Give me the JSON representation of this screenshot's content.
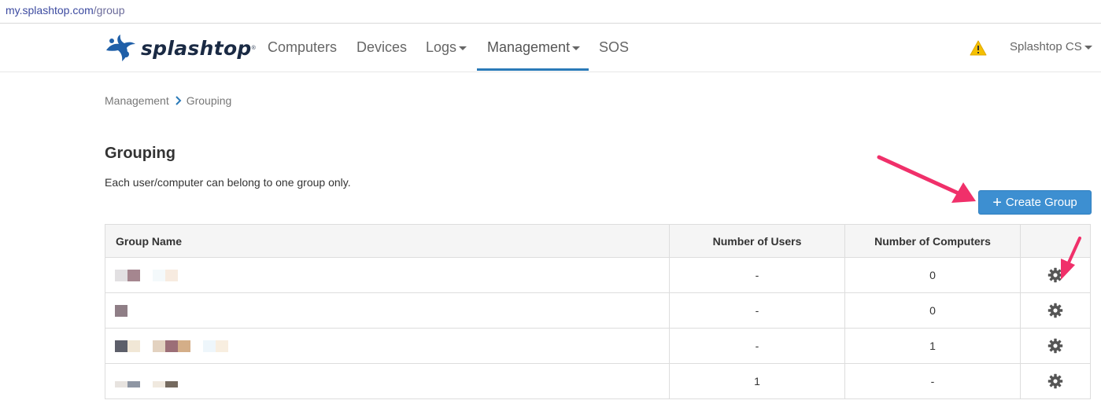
{
  "browser": {
    "url_host": "my.splashtop.com",
    "url_path": "/group"
  },
  "nav": {
    "brand": "splashtop",
    "items": [
      {
        "label": "Computers",
        "dropdown": false
      },
      {
        "label": "Devices",
        "dropdown": false
      },
      {
        "label": "Logs",
        "dropdown": true
      },
      {
        "label": "Management",
        "dropdown": true,
        "active": true
      },
      {
        "label": "SOS",
        "dropdown": false
      }
    ],
    "warning_icon": "warning-triangle-icon",
    "account_label": "Splashtop CS"
  },
  "breadcrumb": {
    "parent": "Management",
    "current": "Grouping"
  },
  "page": {
    "title": "Grouping",
    "description": "Each user/computer can belong to one group only.",
    "create_button_label": "Create Group"
  },
  "table": {
    "columns": [
      "Group Name",
      "Number of Users",
      "Number of Computers",
      ""
    ],
    "rows": [
      {
        "name_redacted": true,
        "users": "-",
        "computers": "0"
      },
      {
        "name_redacted": true,
        "users": "-",
        "computers": "0"
      },
      {
        "name_redacted": true,
        "users": "-",
        "computers": "1"
      },
      {
        "name_redacted": true,
        "users": "1",
        "computers": "-"
      }
    ]
  },
  "colors": {
    "accent": "#2a7ab8",
    "button": "#3d8fd1",
    "annotation_arrow": "#f0306a",
    "warning": "#f5c000"
  }
}
